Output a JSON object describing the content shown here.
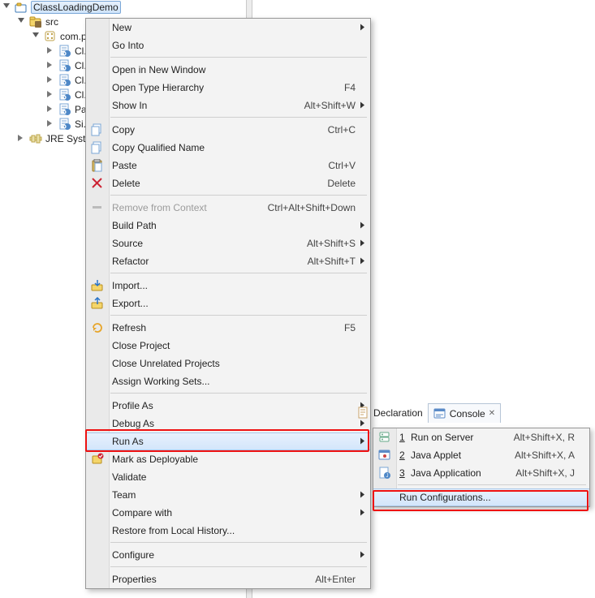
{
  "tree": {
    "project": "ClassLoadingDemo",
    "src": "src",
    "pkg": "com.p...",
    "units": [
      "Cl...",
      "Cl...",
      "Cl...",
      "Cl...",
      "Pa...",
      "Si..."
    ],
    "jre": "JRE Syste..."
  },
  "menu": {
    "new": "New",
    "go_into": "Go Into",
    "open_new_window": "Open in New Window",
    "open_type_hierarchy": "Open Type Hierarchy",
    "open_type_hierarchy_sc": "F4",
    "show_in": "Show In",
    "show_in_sc": "Alt+Shift+W",
    "copy": "Copy",
    "copy_sc": "Ctrl+C",
    "copy_qn": "Copy Qualified Name",
    "paste": "Paste",
    "paste_sc": "Ctrl+V",
    "delete": "Delete",
    "delete_sc": "Delete",
    "remove_ctx": "Remove from Context",
    "remove_ctx_sc": "Ctrl+Alt+Shift+Down",
    "build_path": "Build Path",
    "source": "Source",
    "source_sc": "Alt+Shift+S",
    "refactor": "Refactor",
    "refactor_sc": "Alt+Shift+T",
    "import": "Import...",
    "export": "Export...",
    "refresh": "Refresh",
    "refresh_sc": "F5",
    "close_project": "Close Project",
    "close_unrelated": "Close Unrelated Projects",
    "assign_ws": "Assign Working Sets...",
    "profile_as": "Profile As",
    "debug_as": "Debug As",
    "run_as": "Run As",
    "mark_deployable": "Mark as Deployable",
    "validate": "Validate",
    "team": "Team",
    "compare_with": "Compare with",
    "restore_local": "Restore from Local History...",
    "configure": "Configure",
    "properties": "Properties",
    "properties_sc": "Alt+Enter"
  },
  "tabs": {
    "declaration": "Declaration",
    "console": "Console",
    "console_close": "✕"
  },
  "submenu": {
    "run_on_server_idx": "1",
    "run_on_server": "Run on Server",
    "run_on_server_sc": "Alt+Shift+X, R",
    "java_applet_idx": "2",
    "java_applet": "Java Applet",
    "java_applet_sc": "Alt+Shift+X, A",
    "java_app_idx": "3",
    "java_app": "Java Application",
    "java_app_sc": "Alt+Shift+X, J",
    "run_config": "Run Configurations..."
  }
}
